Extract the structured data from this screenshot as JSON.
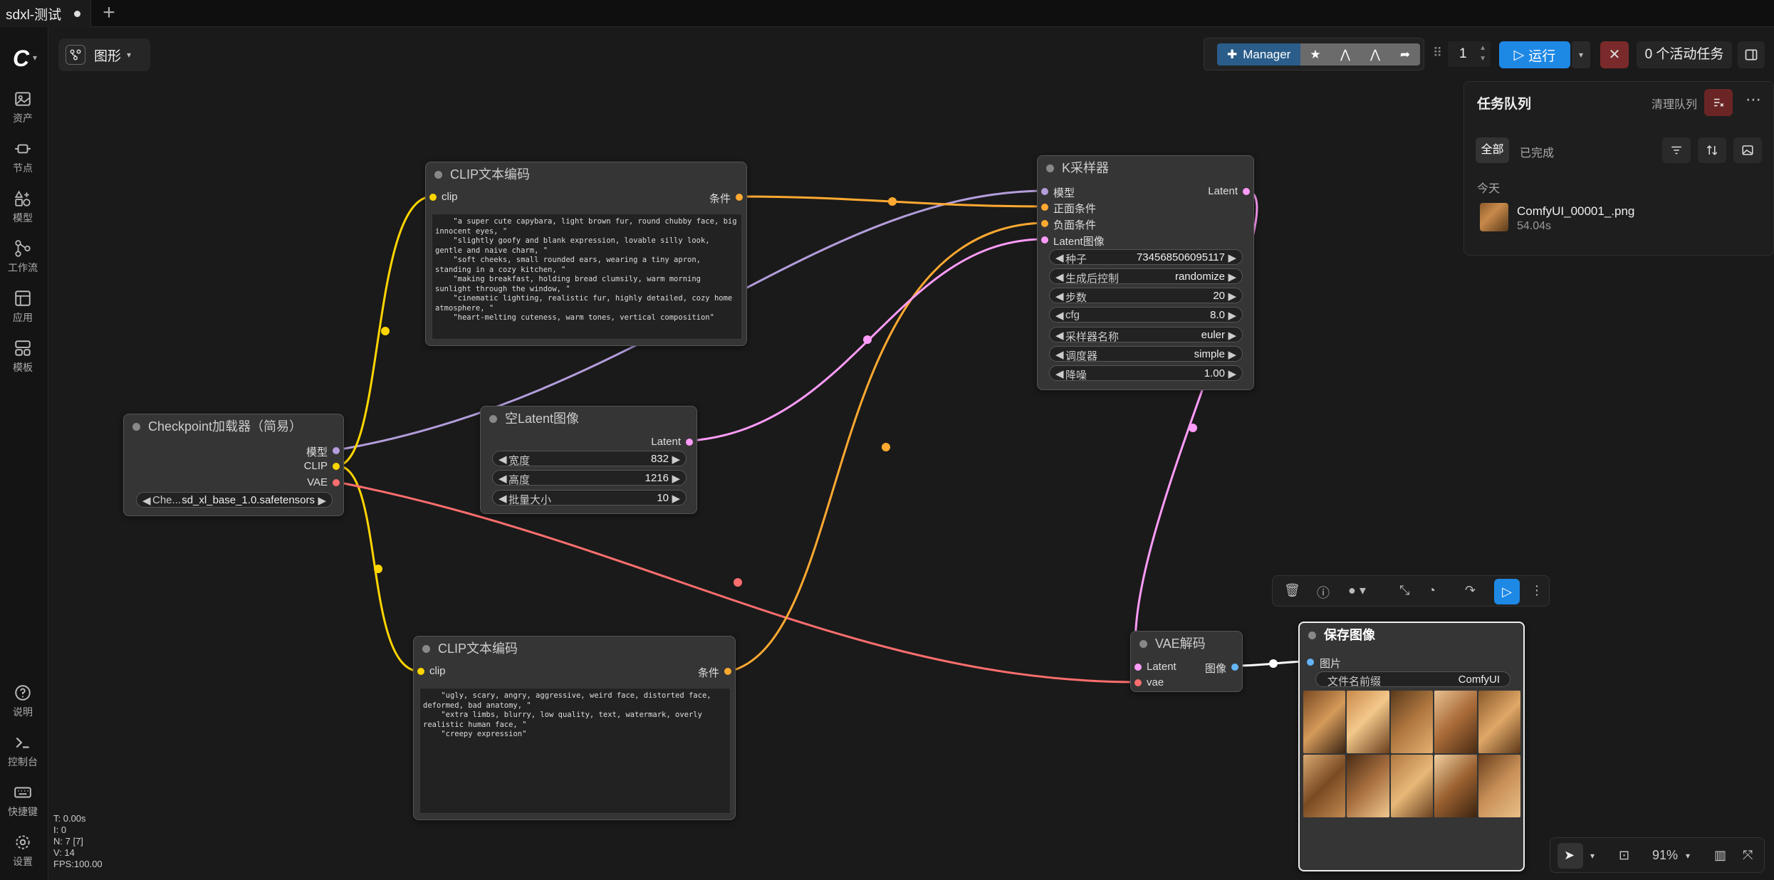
{
  "tab": {
    "title": "sdxl-测试",
    "new_tab": "+"
  },
  "sidebar": {
    "logo": "C",
    "items": [
      {
        "label": "资产",
        "icon": "image-icon"
      },
      {
        "label": "节点",
        "icon": "node-icon"
      },
      {
        "label": "模型",
        "icon": "model-icon"
      },
      {
        "label": "工作流",
        "icon": "workflow-icon"
      },
      {
        "label": "应用",
        "icon": "app-icon"
      },
      {
        "label": "模板",
        "icon": "template-icon"
      }
    ],
    "bottom_items": [
      {
        "label": "说明",
        "icon": "help-icon"
      },
      {
        "label": "控制台",
        "icon": "console-icon"
      },
      {
        "label": "快捷键",
        "icon": "keyboard-icon"
      },
      {
        "label": "设置",
        "icon": "settings-icon"
      }
    ]
  },
  "stats": [
    "T: 0.00s",
    "I: 0",
    "N: 7 [7]",
    "V: 14",
    "FPS:100.00"
  ],
  "graph_selector": {
    "label": "图形"
  },
  "toolbar": {
    "manager_label": "Manager",
    "queue_count": "1",
    "run_label": "运行",
    "active_tasks": "0 个活动任务"
  },
  "queue": {
    "title": "任务队列",
    "clear_label": "清理队列",
    "tab_all": "全部",
    "tab_done": "已完成",
    "today": "今天",
    "item_name": "ComfyUI_00001_.png",
    "item_time": "54.04s"
  },
  "nodes": {
    "clip_pos": {
      "title": "CLIP文本编码",
      "input": "clip",
      "output": "条件",
      "text": "    \"a super cute capybara, light brown fur, round chubby face, big innocent eyes, \"\n    \"slightly goofy and blank expression, lovable silly look, gentle and naive charm, \"\n    \"soft cheeks, small rounded ears, wearing a tiny apron, standing in a cozy kitchen, \"\n    \"making breakfast, holding bread clumsily, warm morning sunlight through the window, \"\n    \"cinematic lighting, realistic fur, highly detailed, cozy home atmosphere, \"\n    \"heart-melting cuteness, warm tones, vertical composition\""
    },
    "clip_neg": {
      "title": "CLIP文本编码",
      "input": "clip",
      "output": "条件",
      "text": "    \"ugly, scary, angry, aggressive, weird face, distorted face, deformed, bad anatomy, \"\n    \"extra limbs, blurry, low quality, text, watermark, overly realistic human face, \"\n    \"creepy expression\""
    },
    "checkpoint": {
      "title": "Checkpoint加载器（简易）",
      "out_model": "模型",
      "out_clip": "CLIP",
      "out_vae": "VAE",
      "widget_name": "Che...",
      "widget_value": "sd_xl_base_1.0.safetensors"
    },
    "latent": {
      "title": "空Latent图像",
      "output": "Latent",
      "w_width": "宽度",
      "v_width": "832",
      "w_height": "高度",
      "v_height": "1216",
      "w_batch": "批量大小",
      "v_batch": "10"
    },
    "ksampler": {
      "title": "K采样器",
      "in_model": "模型",
      "in_pos": "正面条件",
      "in_neg": "负面条件",
      "in_latent": "Latent图像",
      "output": "Latent",
      "widgets": [
        {
          "name": "种子",
          "value": "734568506095117"
        },
        {
          "name": "生成后控制",
          "value": "randomize"
        },
        {
          "name": "步数",
          "value": "20"
        },
        {
          "name": "cfg",
          "value": "8.0"
        },
        {
          "name": "采样器名称",
          "value": "euler"
        },
        {
          "name": "调度器",
          "value": "simple"
        },
        {
          "name": "降噪",
          "value": "1.00"
        }
      ]
    },
    "vae_decode": {
      "title": "VAE解码",
      "in_latent": "Latent",
      "in_vae": "vae",
      "output": "图像"
    },
    "save_image": {
      "title": "保存图像",
      "input": "图片",
      "w_prefix": "文件名前缀",
      "v_prefix": "ComfyUI"
    }
  },
  "zoom": "91%",
  "colors": {
    "model_link": "#b39ddb",
    "clip_link": "#ffd500",
    "vae_link": "#ff6e6e",
    "cond_link": "#ffa931",
    "latent_link": "#ff9cf9",
    "image_link": "#64b5f6",
    "accent": "#1e88e5"
  }
}
